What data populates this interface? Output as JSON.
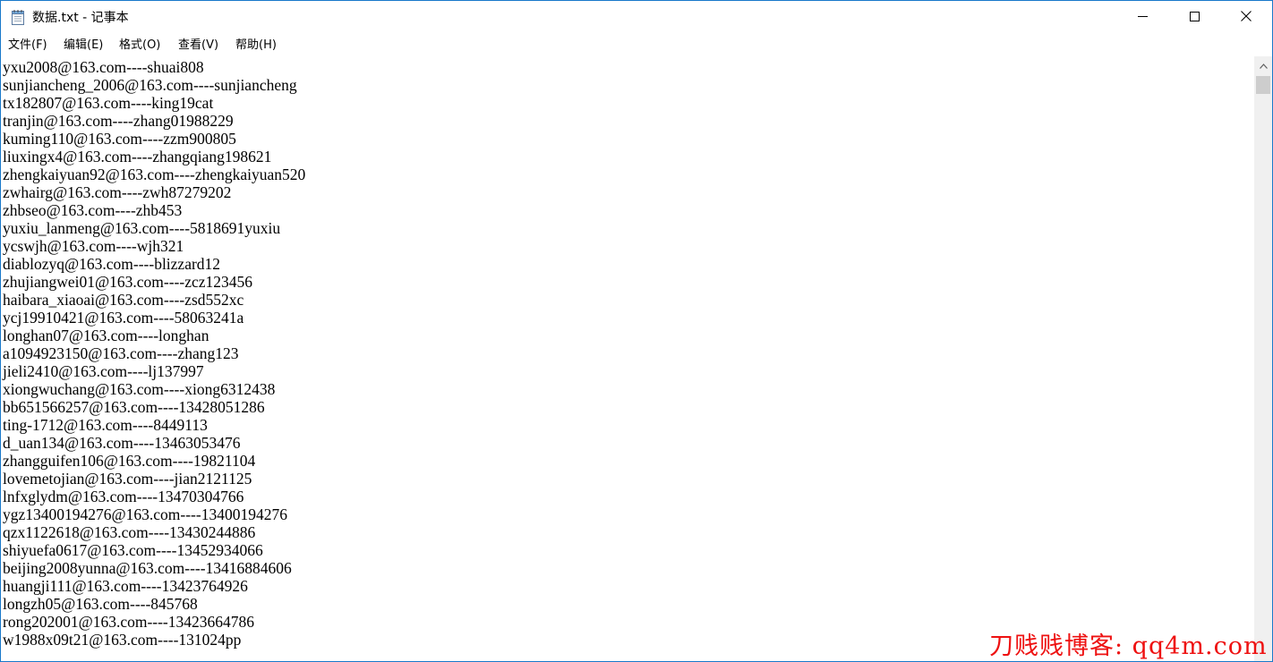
{
  "window": {
    "title": "数据.txt - 记事本"
  },
  "menu": [
    {
      "label": "文件(F)"
    },
    {
      "label": "编辑(E)"
    },
    {
      "label": "格式(O)"
    },
    {
      "label": "查看(V)"
    },
    {
      "label": "帮助(H)"
    }
  ],
  "icons": {
    "app": "notepad-icon",
    "minimize": "minimize-icon",
    "maximize": "maximize-icon",
    "close": "close-icon",
    "scroll_up": "chevron-up-icon"
  },
  "colors": {
    "window_border": "#1979ca",
    "watermark": "#ee1111",
    "scrollbar_track": "#f0f0f0",
    "scrollbar_thumb": "#cdcdcd"
  },
  "editor": {
    "lines": [
      "yxu2008@163.com----shuai808",
      "sunjiancheng_2006@163.com----sunjiancheng",
      "tx182807@163.com----king19cat",
      "tranjin@163.com----zhang01988229",
      "kuming110@163.com----zzm900805",
      "liuxingx4@163.com----zhangqiang198621",
      "zhengkaiyuan92@163.com----zhengkaiyuan520",
      "zwhairg@163.com----zwh87279202",
      "zhbseo@163.com----zhb453",
      "yuxiu_lanmeng@163.com----5818691yuxiu",
      "ycswjh@163.com----wjh321",
      "diablozyq@163.com----blizzard12",
      "zhujiangwei01@163.com----zcz123456",
      "haibara_xiaoai@163.com----zsd552xc",
      "ycj19910421@163.com----58063241a",
      "longhan07@163.com----longhan",
      "a1094923150@163.com----zhang123",
      "jieli2410@163.com----lj137997",
      "xiongwuchang@163.com----xiong6312438",
      "bb651566257@163.com----13428051286",
      "ting-1712@163.com----8449113",
      "d_uan134@163.com----13463053476",
      "zhangguifen106@163.com----19821104",
      "lovemetojian@163.com----jian2121125",
      "lnfxglydm@163.com----13470304766",
      "ygz13400194276@163.com----13400194276",
      "qzx1122618@163.com----13430244886",
      "shiyuefa0617@163.com----13452934066",
      "beijing2008yunna@163.com----13416884606",
      "huangji111@163.com----13423764926",
      "longzh05@163.com----845768",
      "rong202001@163.com----13423664786",
      "w1988x09t21@163.com----131024pp"
    ]
  },
  "watermark": {
    "text": "刀贱贱博客: qq4m.com"
  }
}
